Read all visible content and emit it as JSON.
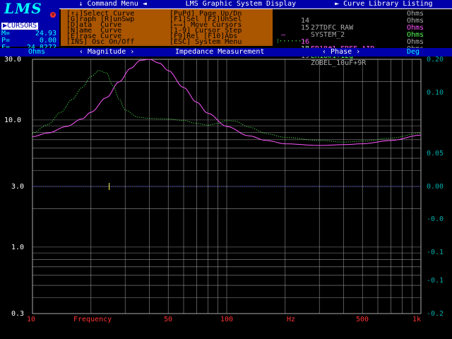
{
  "menu": {
    "items": [
      "Command Menu",
      "LMS Graphic System Display",
      "Curve Library Listing"
    ]
  },
  "logo": {
    "text": "LMS",
    "mark": "®"
  },
  "cursors": {
    "title": "CURSORS",
    "rows": [
      {
        "label": "M=",
        "value": "24.93"
      },
      {
        "label": "P=",
        "value": "0.00"
      },
      {
        "label": "F=",
        "value": "24.8272"
      }
    ]
  },
  "commands": {
    "left": [
      "[↑↓]Select Curve",
      "[G]raph [R]unSwp",
      "[D]ata  Curve",
      "[N]ame  Curve",
      "[E]rase Curve",
      "[INS] Osc On/Off"
    ],
    "right": [
      "[PuPd] Page Up/Dn",
      "[F1]Sel [F2]UnSel",
      "[←→] Move Cursors",
      "[1-9] Cursor Step",
      "[F9]Rel [F10]Abs",
      "[ESC] System Menu"
    ]
  },
  "curves": [
    {
      "num": "14",
      "name": "27TDFC_RAW",
      "unit": "Ohms",
      "color": "#aaaaaa",
      "marker": ""
    },
    {
      "num": "15",
      "name": "SYSTEM_2",
      "unit": "Ohms",
      "color": "#aaaaaa",
      "marker": ""
    },
    {
      "num": "16",
      "name": "ER18#1_FREE AIR",
      "unit": "Ohms",
      "color": "#ff55ff",
      "marker": "—"
    },
    {
      "num": "17",
      "name": "ER18#1+12g",
      "unit": "Ohms",
      "color": "#55ff55",
      "marker": "⁝·······"
    },
    {
      "num": "18",
      "name": "",
      "unit": "Ohms",
      "color": "#aaaaaa",
      "marker": ""
    },
    {
      "num": "19",
      "name": "ZOBEL_10uF+9R",
      "unit": "Ohms",
      "color": "#aaaaaa",
      "marker": ""
    }
  ],
  "title_bar": {
    "left_unit": "Ohms",
    "magnitude": "‹ Magnitude ›",
    "title": "Impedance Measurement",
    "phase": "‹ Phase ›",
    "right_unit": "Deg"
  },
  "colors": {
    "background": "#000000",
    "menu_bg": "#0000aa",
    "cmd_bg": "#aa5500",
    "grid": "#aaaaaa",
    "curve_free_air": "#ff55ff",
    "curve_mass": "#55ff55",
    "phase_line": "#5555ff",
    "x_labels": "#ff3333"
  },
  "chart_data": {
    "type": "line",
    "title": "Impedance Measurement",
    "xlabel": "Frequency",
    "ylabel": "Ohms",
    "y2label": "Deg",
    "x_scale": "log",
    "y_scale": "log",
    "xlim": [
      10,
      1000
    ],
    "ylim": [
      0.3,
      30
    ],
    "y2lim": [
      -0.2,
      0.2
    ],
    "x_ticks": [
      10,
      50,
      100,
      500,
      1000
    ],
    "x_tick_labels": [
      "10",
      "50",
      "100",
      "Hz",
      "500",
      "1k"
    ],
    "y_ticks": [
      30,
      10,
      3,
      1,
      0.3
    ],
    "y_tick_labels": [
      "30.0",
      "10.0",
      "3.0",
      "1.0",
      "0.3"
    ],
    "y2_tick_labels": [
      "0.20",
      "0.10",
      "0.05",
      "0.00",
      "-0.0",
      "-0.1",
      "-0.1",
      "-0.2"
    ],
    "grid": true,
    "series": [
      {
        "name": "ER18#1_FREE AIR",
        "color": "#ff55ff",
        "style": "solid",
        "x": [
          10,
          12,
          15,
          18,
          20,
          24,
          28,
          32,
          36,
          40,
          45,
          50,
          60,
          70,
          80,
          100,
          130,
          160,
          200,
          300,
          400,
          500,
          700,
          1000
        ],
        "y": [
          7.4,
          7.9,
          8.9,
          10.2,
          11.5,
          15.0,
          20.0,
          25.5,
          29.5,
          30.0,
          28.0,
          24.5,
          18.0,
          13.8,
          11.3,
          8.9,
          7.5,
          6.9,
          6.5,
          6.3,
          6.4,
          6.5,
          6.9,
          7.6
        ]
      },
      {
        "name": "ER18#1+12g",
        "color": "#55ff55",
        "style": "dotted",
        "x": [
          10,
          12,
          14,
          16,
          18,
          20,
          22,
          24,
          26,
          28,
          30,
          35,
          40,
          50,
          60,
          70,
          80,
          90,
          100,
          110,
          130,
          160,
          200,
          300,
          400,
          500,
          700,
          1000
        ],
        "y": [
          7.9,
          9.2,
          11.5,
          14.5,
          18.0,
          22.0,
          24.5,
          23.5,
          18.5,
          14.5,
          12.0,
          10.5,
          10.3,
          10.2,
          9.9,
          9.4,
          9.1,
          9.4,
          9.9,
          9.8,
          8.8,
          7.8,
          7.3,
          6.9,
          6.7,
          6.8,
          7.2,
          7.9
        ]
      }
    ]
  }
}
